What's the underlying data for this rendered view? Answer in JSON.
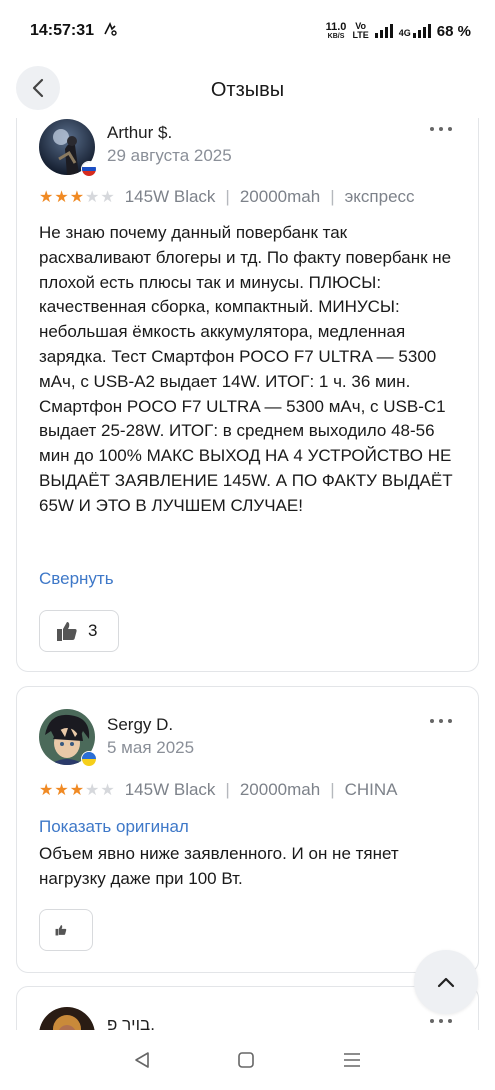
{
  "status_bar": {
    "time": "14:57:31",
    "net_speed_value": "11.0",
    "net_speed_unit": "KB/S",
    "volte_top": "Vo",
    "volte_bottom": "LTE",
    "network": "4G",
    "battery": "68 %"
  },
  "header": {
    "title": "Отзывы"
  },
  "reviews": [
    {
      "author": "Arthur $.",
      "date": "29 августа 2025",
      "rating": 3,
      "rating_max": 5,
      "variant": "145W Black",
      "capacity": "20000mah",
      "delivery": "экспресс",
      "text": "Не знаю почему данный повербанк так расхваливают блогеры и тд. По факту повербанк не плохой есть плюсы так и минусы.  ПЛЮСЫ: качественная сборка, компактный.  МИНУСЫ: небольшая ёмкость аккумулятора, медленная зарядка.   Тест Смартфон POCO F7 ULTRA — 5300 мАч, с USB-A2 выдает 14W. ИТОГ: 1 ч. 36 мин. Смартфон POCO F7 ULTRA — 5300 мАч, с USB-C1 выдает 25-28W.  ИТОГ: в среднем выходило 48-56 мин до 100%   МАКС ВЫХОД НА 4 УСТРОЙСТВО НЕ ВЫДАЁТ ЗАЯВЛЕНИЕ 145W. А ПО ФАКТУ ВЫДАЁТ 65W И ЭТО В ЛУЧШЕМ СЛУЧАЕ!",
      "collapse_label": "Свернуть",
      "likes": "3"
    },
    {
      "author": "Sergy D.",
      "date": "5 мая 2025",
      "rating": 3,
      "rating_max": 5,
      "variant": "145W Black",
      "capacity": "20000mah",
      "delivery": "CHINA",
      "show_original_label": "Показать оригинал",
      "text": "Объем явно ниже заявленного. И он не тянет нагрузку даже при 100 Вт.",
      "likes": ""
    },
    {
      "author": "בויר פ."
    }
  ],
  "icons": {
    "back": "chevron-left-icon",
    "more": "more-dots-icon",
    "like": "thumbs-up-icon",
    "scroll_top": "chevron-up-icon",
    "flag_review1": "russia-flag-icon",
    "flag_review2": "ukraine-flag-icon"
  },
  "colors": {
    "star": "#f08a24",
    "link": "#3e78c8",
    "secondary_text": "#8a8f98"
  }
}
